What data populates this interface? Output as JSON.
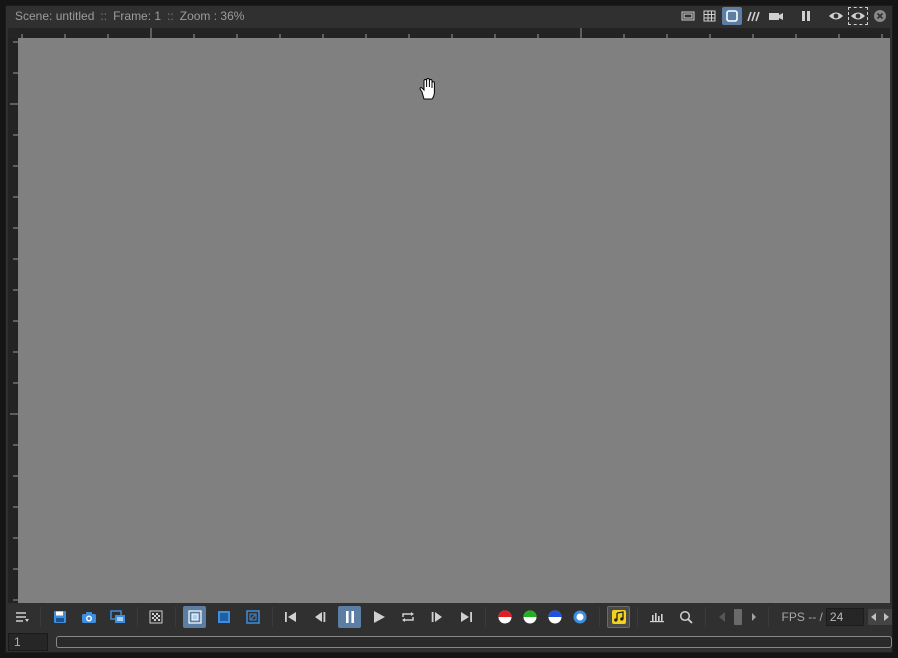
{
  "title_bar": {
    "scene": "Scene: untitled",
    "sep1": "::",
    "frame": "Frame: 1",
    "sep2": "::",
    "zoom": "Zoom : 36%"
  },
  "title_icons": [
    "single-view-icon",
    "grid-view-icon",
    "frame-view-icon",
    "motion-icon",
    "camera-icon",
    "pause-icon",
    "eye-icon",
    "eye-dotted-icon",
    "close-icon"
  ],
  "toolbar": {
    "buttons": [
      "menu-icon",
      "save-icon",
      "camera-snapshot-icon",
      "compare-icon",
      "checker-icon",
      "fit-frame-icon",
      "fill-frame-icon",
      "actual-size-icon",
      "first-frame-icon",
      "prev-frame-icon",
      "pause-icon",
      "play-icon",
      "loop-icon",
      "next-frame-icon",
      "last-frame-icon",
      "red-channel-icon",
      "green-channel-icon",
      "blue-channel-icon",
      "alpha-channel-icon",
      "sound-icon",
      "histogram-icon",
      "zoom-icon"
    ],
    "fps_label": "FPS -- /",
    "fps_value": "24"
  },
  "bottom": {
    "frame_value": "1"
  },
  "colors": {
    "canvas": "#808080",
    "accent": "#5d7ea3",
    "sound_accent": "#f2d21a"
  }
}
